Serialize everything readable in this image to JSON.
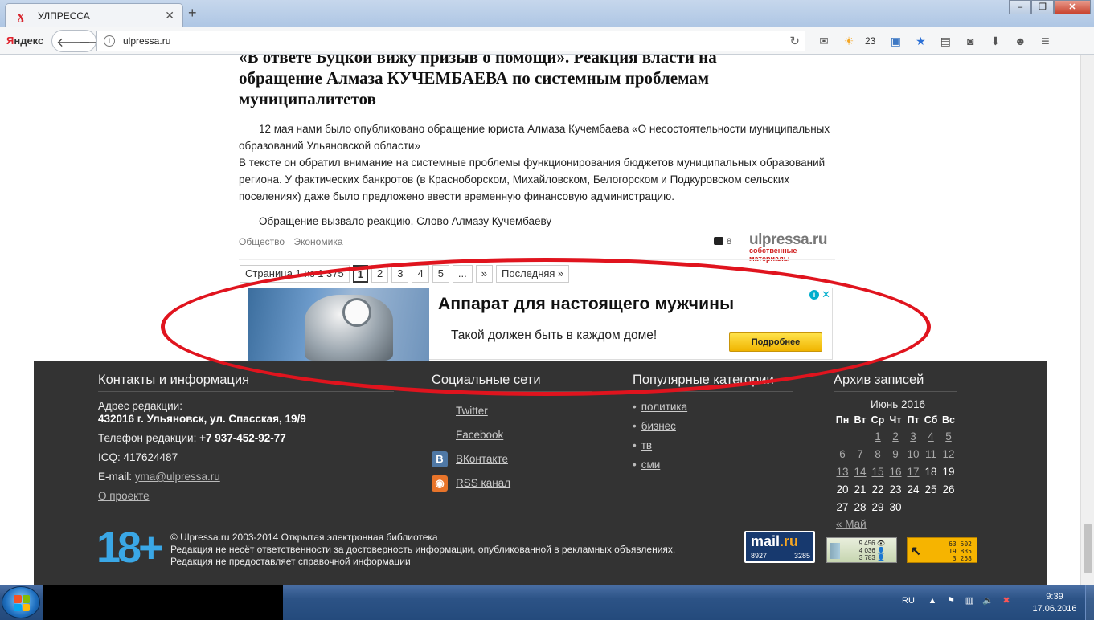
{
  "browser": {
    "tab_title": "УЛПРЕССА",
    "tab_favicon": "ɣ",
    "new_tab_symbol": "+",
    "close_tab_symbol": "✕",
    "window_controls": {
      "minimize": "–",
      "maximize": "❐",
      "close": "✕"
    },
    "logo_first": "Я",
    "logo_rest": "ндекс",
    "url": "ulpressa.ru",
    "weather_temp": "23",
    "icons": [
      "mail-icon",
      "weather-icon",
      "addon-icon",
      "bookmark-star-icon",
      "reading-list-icon",
      "pocket-icon",
      "download-icon",
      "chat-icon",
      "menu-icon"
    ]
  },
  "article": {
    "title": "«В ответе Буцкой вижу призыв о помощи». Реакция власти на обращение Алмаза КУЧЕМБАЕВА по системным проблемам муниципалитетов",
    "para1_line1": "12 мая нами было опубликовано обращение юриста Алмаза Кучембаева «О несостоятельности муниципальных образований Ульяновской области»",
    "para1_line2": "В тексте он обратил внимание на системные проблемы функционирования бюджетов муниципальных образований региона. У фактических банкротов (в Красноборском, Михайловском, Белогорском и Подкуровском сельских поселениях) даже было предложено ввести временную финансовую администрацию.",
    "para2": "Обращение вызвало реакцию. Слово Алмазу Кучембаеву",
    "tags": [
      "Общество",
      "Экономика"
    ],
    "comments_count": "8",
    "brand_name": "ulpressa.ru",
    "brand_sub": "собственные материалы"
  },
  "pager": {
    "info": "Страница 1 из 1 375",
    "pages": [
      "1",
      "2",
      "3",
      "4",
      "5"
    ],
    "current": "1",
    "ellipsis": "...",
    "next": "»",
    "last": "Последняя »"
  },
  "ad": {
    "title": "Аппарат для настоящего мужчины",
    "text": "Такой должен быть в каждом доме!",
    "button": "Подробнее",
    "info_symbol": "i",
    "close_symbol": "✕"
  },
  "footer": {
    "contacts_heading": "Контакты и информация",
    "social_heading": "Социальные сети",
    "categories_heading": "Популярные категории",
    "archive_heading": "Архив записей",
    "address_label": "Адрес редакции:",
    "address_value": "432016 г. Ульяновск, ул. Спасская, 19/9",
    "phone_label": "Телефон редакции: ",
    "phone_value": "+7 937-452-92-77",
    "icq": "ICQ: 417624487",
    "email_label": "E-mail: ",
    "email_value": "yma@ulpressa.ru",
    "about_link": "О проекте",
    "social": [
      {
        "label": "Twitter",
        "icon": ""
      },
      {
        "label": "Facebook",
        "icon": ""
      },
      {
        "label": "ВКонтакте",
        "icon": "B"
      },
      {
        "label": "RSS канал",
        "icon": "◉"
      }
    ],
    "categories": [
      "политика",
      "бизнес",
      "тв",
      "сми"
    ],
    "calendar": {
      "month": "Июнь 2016",
      "weekdays": [
        "Пн",
        "Вт",
        "Ср",
        "Чт",
        "Пт",
        "Сб",
        "Вс"
      ],
      "weeks": [
        [
          "",
          "",
          "1",
          "2",
          "3",
          "4",
          "5"
        ],
        [
          "6",
          "7",
          "8",
          "9",
          "10",
          "11",
          "12"
        ],
        [
          "13",
          "14",
          "15",
          "16",
          "17",
          "18",
          "19"
        ],
        [
          "20",
          "21",
          "22",
          "23",
          "24",
          "25",
          "26"
        ],
        [
          "27",
          "28",
          "29",
          "30",
          "",
          "",
          ""
        ]
      ],
      "linked_days": [
        "1",
        "2",
        "3",
        "4",
        "5",
        "6",
        "7",
        "8",
        "9",
        "10",
        "11",
        "12",
        "13",
        "14",
        "15",
        "16",
        "17"
      ],
      "prev_link": "« Май"
    },
    "age_badge": "18+",
    "copyright_lines": [
      "© Ulpressa.ru 2003-2014 Открытая электронная библиотека",
      "Редакция не несёт ответственности за достоверность информации, опубликованной в рекламных объявлениях.",
      "Редакция не предоставляет справочной информации"
    ],
    "counter_mail": {
      "logo": "mail",
      "logo_ru": ".ru",
      "left": "8927",
      "right": "3285"
    },
    "counter_li": [
      "9 456 👁",
      "4 036 👤",
      "3 783 👤"
    ],
    "counter_ya": [
      "63 502",
      "19 835",
      "3 258"
    ]
  },
  "taskbar": {
    "lang": "RU",
    "time": "9:39",
    "date": "17.06.2016",
    "tray_icons": [
      "show-hidden-icon",
      "flag-icon",
      "network-icon",
      "volume-icon",
      "antivirus-icon",
      "power-icon"
    ]
  },
  "colors": {
    "annotation": "#e0141e",
    "footer_bg": "#333333",
    "ad_button": "#f5c400",
    "badge_blue": "#3aa7e6"
  }
}
